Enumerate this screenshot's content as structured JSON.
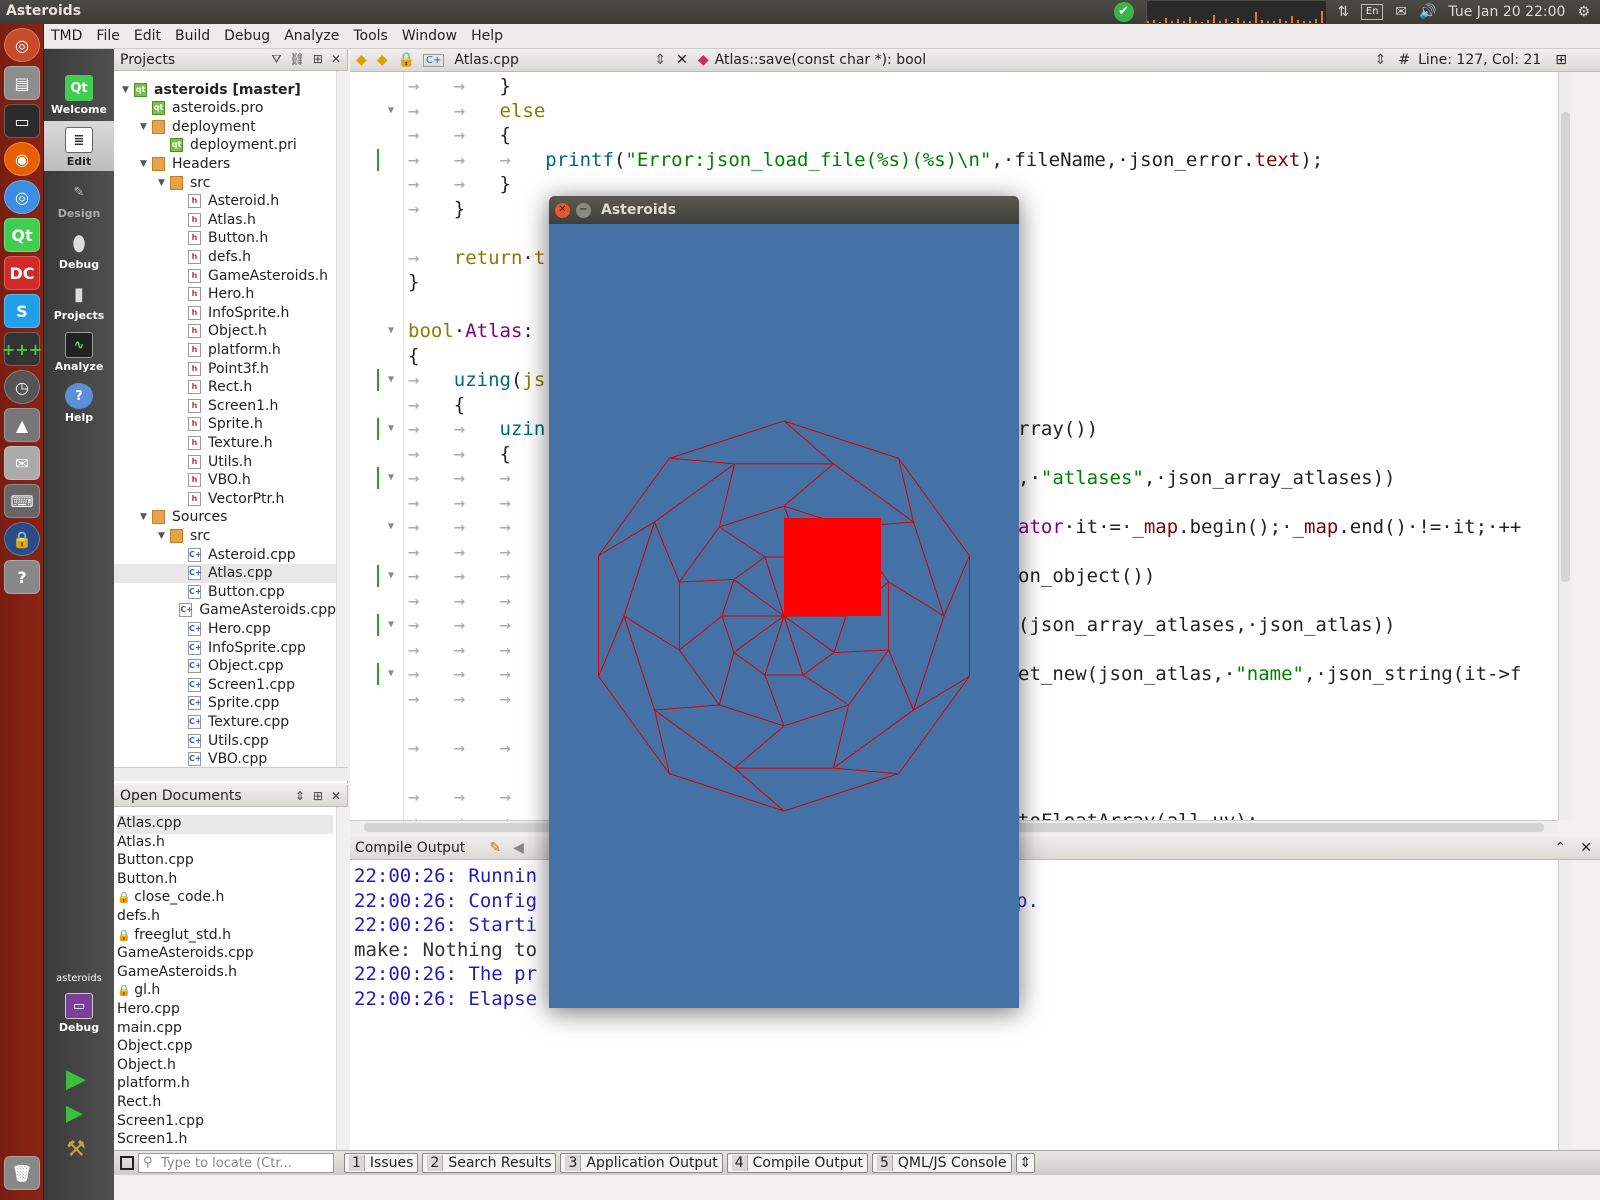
{
  "system_panel": {
    "app_title": "Asteroids",
    "keyboard_lang": "En",
    "clock": "Tue Jan 20 22:00"
  },
  "menubar": [
    "TMD",
    "File",
    "Edit",
    "Build",
    "Debug",
    "Analyze",
    "Tools",
    "Window",
    "Help"
  ],
  "modes": [
    "Welcome",
    "Edit",
    "Design",
    "Debug",
    "Projects",
    "Analyze",
    "Help"
  ],
  "kit": {
    "project": "asteroids",
    "mode": "Debug"
  },
  "projects_pane": {
    "title": "Projects",
    "tree": [
      {
        "label": "asteroids [master]",
        "kind": "pro",
        "depth": 0,
        "bold": true
      },
      {
        "label": "asteroids.pro",
        "kind": "pro",
        "depth": 1
      },
      {
        "label": "deployment",
        "kind": "folder",
        "depth": 1
      },
      {
        "label": "deployment.pri",
        "kind": "pro",
        "depth": 2
      },
      {
        "label": "Headers",
        "kind": "folder",
        "depth": 1
      },
      {
        "label": "src",
        "kind": "folder",
        "depth": 2
      },
      {
        "label": "Asteroid.h",
        "kind": "h",
        "depth": 3
      },
      {
        "label": "Atlas.h",
        "kind": "h",
        "depth": 3
      },
      {
        "label": "Button.h",
        "kind": "h",
        "depth": 3
      },
      {
        "label": "defs.h",
        "kind": "h",
        "depth": 3
      },
      {
        "label": "GameAsteroids.h",
        "kind": "h",
        "depth": 3
      },
      {
        "label": "Hero.h",
        "kind": "h",
        "depth": 3
      },
      {
        "label": "InfoSprite.h",
        "kind": "h",
        "depth": 3
      },
      {
        "label": "Object.h",
        "kind": "h",
        "depth": 3
      },
      {
        "label": "platform.h",
        "kind": "h",
        "depth": 3
      },
      {
        "label": "Point3f.h",
        "kind": "h",
        "depth": 3
      },
      {
        "label": "Rect.h",
        "kind": "h",
        "depth": 3
      },
      {
        "label": "Screen1.h",
        "kind": "h",
        "depth": 3
      },
      {
        "label": "Sprite.h",
        "kind": "h",
        "depth": 3
      },
      {
        "label": "Texture.h",
        "kind": "h",
        "depth": 3
      },
      {
        "label": "Utils.h",
        "kind": "h",
        "depth": 3
      },
      {
        "label": "VBO.h",
        "kind": "h",
        "depth": 3
      },
      {
        "label": "VectorPtr.h",
        "kind": "h",
        "depth": 3
      },
      {
        "label": "Sources",
        "kind": "folder",
        "depth": 1
      },
      {
        "label": "src",
        "kind": "folder",
        "depth": 2
      },
      {
        "label": "Asteroid.cpp",
        "kind": "cpp",
        "depth": 3
      },
      {
        "label": "Atlas.cpp",
        "kind": "cpp",
        "depth": 3,
        "selected": true
      },
      {
        "label": "Button.cpp",
        "kind": "cpp",
        "depth": 3
      },
      {
        "label": "GameAsteroids.cpp",
        "kind": "cpp",
        "depth": 3
      },
      {
        "label": "Hero.cpp",
        "kind": "cpp",
        "depth": 3
      },
      {
        "label": "InfoSprite.cpp",
        "kind": "cpp",
        "depth": 3
      },
      {
        "label": "Object.cpp",
        "kind": "cpp",
        "depth": 3
      },
      {
        "label": "Screen1.cpp",
        "kind": "cpp",
        "depth": 3
      },
      {
        "label": "Sprite.cpp",
        "kind": "cpp",
        "depth": 3
      },
      {
        "label": "Texture.cpp",
        "kind": "cpp",
        "depth": 3
      },
      {
        "label": "Utils.cpp",
        "kind": "cpp",
        "depth": 3
      },
      {
        "label": "VBO.cpp",
        "kind": "cpp",
        "depth": 3
      }
    ]
  },
  "open_documents": {
    "title": "Open Documents",
    "items": [
      {
        "label": "Atlas.cpp",
        "selected": true
      },
      {
        "label": "Atlas.h"
      },
      {
        "label": "Button.cpp"
      },
      {
        "label": "Button.h"
      },
      {
        "label": "close_code.h",
        "locked": true
      },
      {
        "label": "defs.h"
      },
      {
        "label": "freeglut_std.h",
        "locked": true
      },
      {
        "label": "GameAsteroids.cpp"
      },
      {
        "label": "GameAsteroids.h"
      },
      {
        "label": "gl.h",
        "locked": true
      },
      {
        "label": "Hero.cpp"
      },
      {
        "label": "main.cpp"
      },
      {
        "label": "Object.cpp"
      },
      {
        "label": "Object.h"
      },
      {
        "label": "platform.h"
      },
      {
        "label": "Rect.h"
      },
      {
        "label": "Screen1.cpp"
      },
      {
        "label": "Screen1.h"
      }
    ]
  },
  "editor": {
    "file_tab": "Atlas.cpp",
    "symbol": "Atlas::save(const char *): bool",
    "position": "Line: 127, Col: 21",
    "lines": [
      {
        "indent": 2,
        "html": "}",
        "fold": false
      },
      {
        "indent": 2,
        "html": "<span class=\"kw\">else</span>",
        "fold": true
      },
      {
        "indent": 2,
        "html": "{",
        "fold": false
      },
      {
        "indent": 3,
        "html": "<span class=\"fn\">printf</span>(<span class=\"str\">\"Error:json_load_file(%s)(%s)\\n\"</span>,·fileName,·json_error.<span class=\"mem\">text</span>);",
        "marker": true
      },
      {
        "indent": 2,
        "html": "}"
      },
      {
        "indent": 1,
        "html": "}"
      },
      {
        "indent": 0,
        "html": ""
      },
      {
        "indent": 1,
        "html": "<span class=\"kw\">return</span>·<span class=\"kw\">t</span>"
      },
      {
        "indent": 0,
        "html": "}",
        "noarrow": true
      },
      {
        "indent": 0,
        "html": ""
      },
      {
        "indent": 0,
        "html": "<span class=\"kw\">bool</span>·<span class=\"ty\">Atlas</span>:",
        "noarrow": true,
        "fold": true
      },
      {
        "indent": 0,
        "html": "{",
        "noarrow": true
      },
      {
        "indent": 1,
        "html": "<span class=\"fn\">uzing</span>(<span class=\"kw\">js</span>",
        "marker": true,
        "fold": true
      },
      {
        "indent": 1,
        "html": "{"
      },
      {
        "indent": 2,
        "html": "<span class=\"fn\">uzin</span>",
        "marker": true,
        "fold": true,
        "right": "rray())"
      },
      {
        "indent": 2,
        "html": "{"
      },
      {
        "indent": 3,
        "html": "",
        "marker": true,
        "fold": true,
        "right": ",·<span class=\"str\">\"atlases\"</span>,·json_array_atlases))"
      },
      {
        "indent": 3,
        "html": ""
      },
      {
        "indent": 3,
        "html": "",
        "fold": true,
        "right": "<span class=\"ty\">ator</span>·it·=·<span class=\"mem\">_map</span>.begin();·<span class=\"mem\">_map</span>.end()·!=·it;·++"
      },
      {
        "indent": 3,
        "html": ""
      },
      {
        "indent": 3,
        "html": "",
        "marker": true,
        "fold": true,
        "right": "on_object())"
      },
      {
        "indent": 3,
        "html": ""
      },
      {
        "indent": 3,
        "html": "",
        "marker": true,
        "fold": true,
        "right": "(json_array_atlases,·json_atlas))"
      },
      {
        "indent": 3,
        "html": ""
      },
      {
        "indent": 3,
        "html": "",
        "marker": true,
        "fold": true,
        "right": "et_new(json_atlas,·<span class=\"str\">\"name\"</span>,·json_string(it-&gt;f"
      },
      {
        "indent": 3,
        "html": ""
      },
      {
        "indent": 0,
        "html": ""
      },
      {
        "indent": 3,
        "html": ""
      },
      {
        "indent": 0,
        "html": ""
      },
      {
        "indent": 3,
        "html": ""
      },
      {
        "indent": 3,
        "html": "",
        "right": "toFloatArray(all_uv);"
      }
    ]
  },
  "compile_output": {
    "title": "Compile Output",
    "lines": [
      {
        "text": "22:00:26: Runnin",
        "color": "#1d1dc0"
      },
      {
        "text": "22:00:26: Config",
        "color": "#1d1dc0",
        "tail": "p."
      },
      {
        "text": "22:00:26: Starti",
        "color": "#1d1dc0"
      },
      {
        "text": "make: Nothing to",
        "color": "#333"
      },
      {
        "text": "22:00:26: The pr",
        "color": "#1d1dc0"
      },
      {
        "text": "22:00:26: Elapse",
        "color": "#1d1dc0"
      }
    ]
  },
  "statusbar": {
    "locator_placeholder": "Type to locate (Ctr...",
    "tabs": [
      {
        "num": "1",
        "label": "Issues"
      },
      {
        "num": "2",
        "label": "Search Results"
      },
      {
        "num": "3",
        "label": "Application Output"
      },
      {
        "num": "4",
        "label": "Compile Output"
      },
      {
        "num": "5",
        "label": "QML/JS Console"
      }
    ]
  },
  "game_window": {
    "title": "Asteroids",
    "background": "#4472a6",
    "wire_color": "#d40000",
    "block_color": "#ff0000"
  }
}
